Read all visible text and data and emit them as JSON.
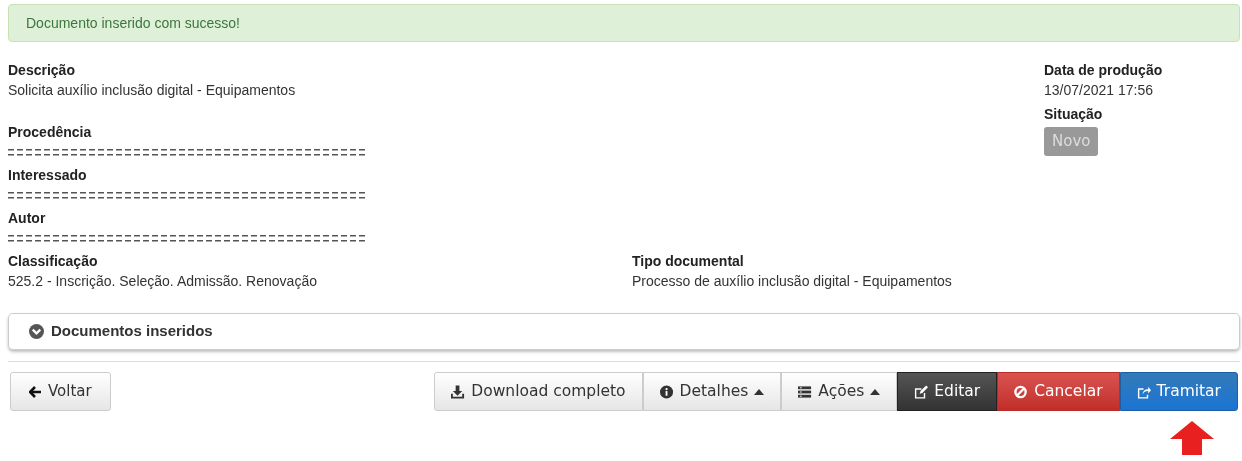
{
  "alert": {
    "text": "Documento inserido com sucesso!"
  },
  "fields_left": [
    {
      "label": "Descrição",
      "value": "Solicita auxílio inclusão digital - Equipamentos"
    },
    {
      "label": "Procedência"
    },
    {
      "label": "Interessado"
    },
    {
      "label": "Autor"
    }
  ],
  "fields_right": [
    {
      "label": "Data de produção",
      "value": "13/07/2021 17:56"
    }
  ],
  "status": {
    "label": "Situação",
    "badge": "Novo"
  },
  "classification_row": [
    {
      "label": "Classificação",
      "value": "525.2 - Inscrição. Seleção. Admissão. Renovação"
    },
    {
      "label": "Tipo documental",
      "value": "Processo de auxílio inclusão digital - Equipamentos"
    }
  ],
  "panel": {
    "title": "Documentos inseridos",
    "expanded": false
  },
  "back_button": {
    "label": "Voltar"
  },
  "actions": [
    {
      "label": "Download completo",
      "kind": "default",
      "caret": false
    },
    {
      "label": "Detalhes",
      "kind": "default",
      "caret": true
    },
    {
      "label": "Ações",
      "kind": "default",
      "caret": true
    },
    {
      "label": "Editar",
      "kind": "dark",
      "caret": false
    },
    {
      "label": "Cancelar",
      "kind": "danger",
      "caret": false
    },
    {
      "label": "Tramitar",
      "kind": "primary",
      "caret": false
    }
  ]
}
